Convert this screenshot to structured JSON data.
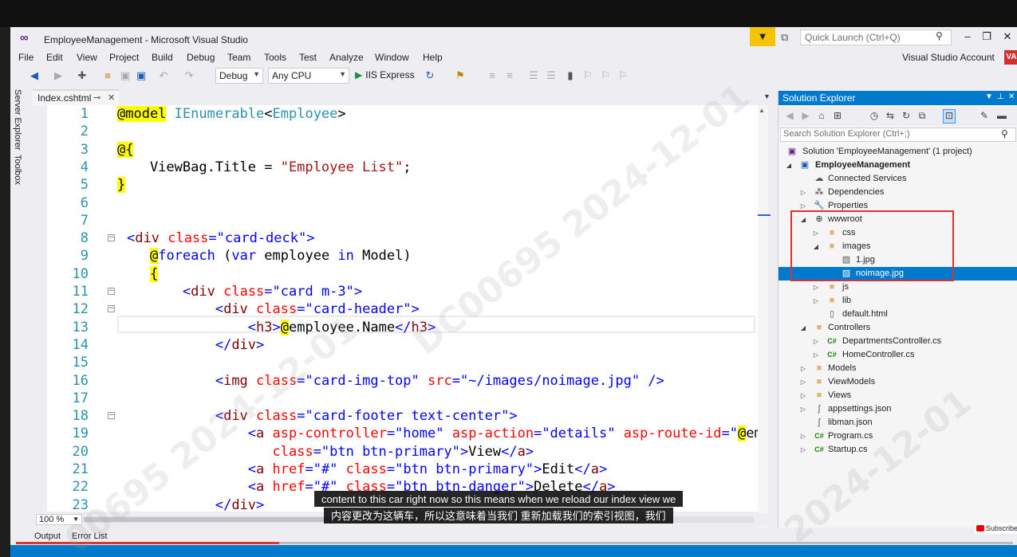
{
  "window": {
    "title": "EmployeeManagement - Microsoft Visual Studio",
    "quick_launch_placeholder": "Quick Launch (Ctrl+Q)",
    "account": "Visual Studio Account",
    "account_badge": "VA"
  },
  "menu": [
    "File",
    "Edit",
    "View",
    "Project",
    "Build",
    "Debug",
    "Team",
    "Tools",
    "Test",
    "Analyze",
    "Window",
    "Help"
  ],
  "toolbar": {
    "config": "Debug",
    "platform": "Any CPU",
    "run_label": "IIS Express"
  },
  "left_strip": [
    "Server Explorer",
    "Toolbox"
  ],
  "editor": {
    "tab": "Index.cshtml",
    "zoom": "100 %",
    "line_numbers": [
      "1",
      "2",
      "3",
      "4",
      "5",
      "6",
      "7",
      "8",
      "9",
      "10",
      "11",
      "12",
      "13",
      "14",
      "15",
      "16",
      "17",
      "18",
      "19",
      "20",
      "21",
      "22",
      "23"
    ]
  },
  "bottom_tabs": [
    "Output",
    "Error List"
  ],
  "solution_explorer": {
    "title": "Solution Explorer",
    "search_placeholder": "Search Solution Explorer (Ctrl+;)",
    "items": [
      {
        "label": "Solution 'EmployeeManagement' (1 project)"
      },
      {
        "label": "EmployeeManagement"
      },
      {
        "label": "Connected Services"
      },
      {
        "label": "Dependencies"
      },
      {
        "label": "Properties"
      },
      {
        "label": "wwwroot"
      },
      {
        "label": "css"
      },
      {
        "label": "images"
      },
      {
        "label": "1.jpg"
      },
      {
        "label": "noimage.jpg"
      },
      {
        "label": "js"
      },
      {
        "label": "lib"
      },
      {
        "label": "default.html"
      },
      {
        "label": "Controllers"
      },
      {
        "label": "DepartmentsController.cs"
      },
      {
        "label": "HomeController.cs"
      },
      {
        "label": "Models"
      },
      {
        "label": "ViewModels"
      },
      {
        "label": "Views"
      },
      {
        "label": "appsettings.json"
      },
      {
        "label": "libman.json"
      },
      {
        "label": "Program.cs"
      },
      {
        "label": "Startup.cs"
      }
    ]
  },
  "subtitles": {
    "en": "content to this car right now so this means when we reload our index view we",
    "zh": "内容更改为这辆车，所以这意味着当我们 重新加载我们的索引视图，我们"
  },
  "subscribe": "Subscribe",
  "colors": {
    "accent": "#007acc",
    "highlight_box": "#e03030",
    "razor_highlight": "#ffff00"
  }
}
